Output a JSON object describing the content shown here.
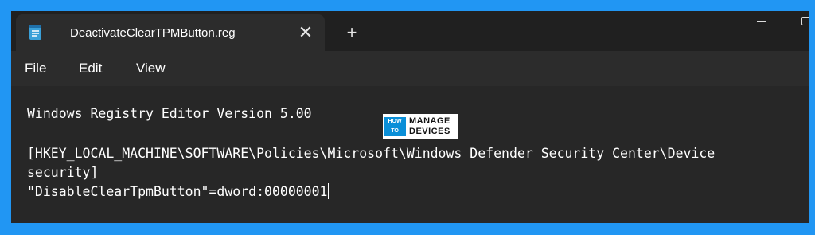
{
  "tab": {
    "title": "DeactivateClearTPMButton.reg",
    "icon": "notepad-icon",
    "close_glyph": "✕"
  },
  "new_tab_glyph": "+",
  "menu": {
    "items": [
      {
        "label": "File"
      },
      {
        "label": "Edit"
      },
      {
        "label": "View"
      }
    ]
  },
  "editor": {
    "lines": [
      "Windows Registry Editor Version 5.00",
      "[HKEY_LOCAL_MACHINE\\SOFTWARE\\Policies\\Microsoft\\Windows Defender Security Center\\Device",
      "security]",
      "\"DisableClearTpmButton\"=dword:00000001"
    ]
  },
  "watermark": {
    "line1": "HOW",
    "line2": "TO",
    "word1": "MANAGE",
    "word2": "DEVICES"
  },
  "colors": {
    "page_background": "#2196f3",
    "window_background": "#202020",
    "editor_background": "#272727",
    "text": "#ffffff",
    "logo_accent": "#0a8fd8"
  }
}
